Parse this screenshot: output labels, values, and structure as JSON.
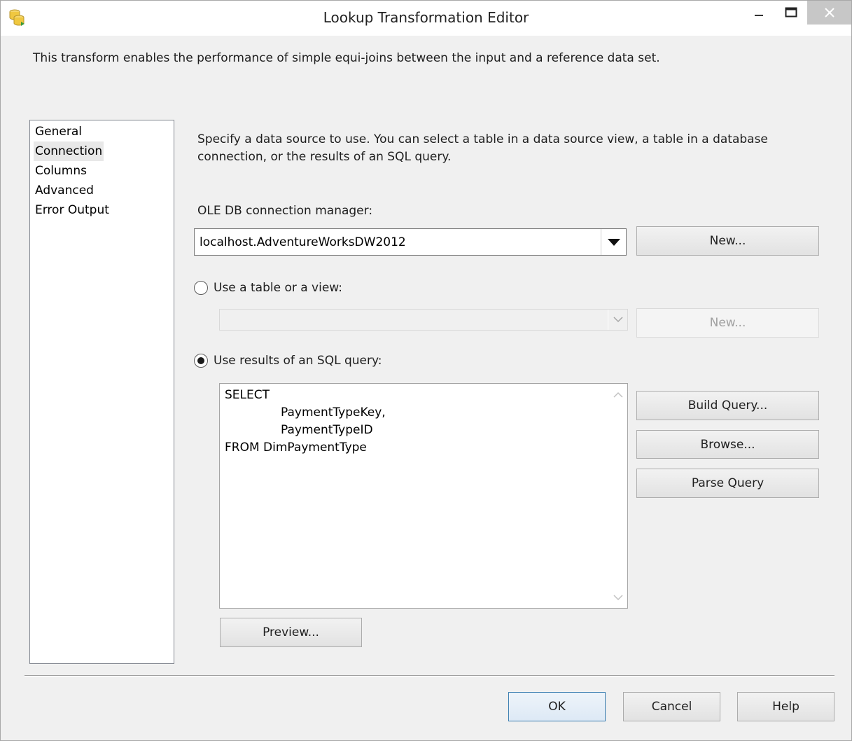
{
  "window": {
    "title": "Lookup Transformation Editor"
  },
  "description": "This transform enables the performance of simple equi-joins between the input and a reference data set.",
  "nav": {
    "items": [
      "General",
      "Connection",
      "Columns",
      "Advanced",
      "Error Output"
    ],
    "selected": "Connection"
  },
  "connection": {
    "instructions": "Specify a data source to use. You can select a table in a data source view, a table in a database connection, or the results of an SQL query.",
    "ole_db_label": "OLE DB connection manager:",
    "ole_db_value": "localhost.AdventureWorksDW2012",
    "new_connection_label": "New...",
    "table_option_label": "Use a table or a view:",
    "table_option_selected": false,
    "table_value": "",
    "new_table_label": "New...",
    "sql_option_label": "Use results of an SQL query:",
    "sql_option_selected": true,
    "query_lines": [
      "SELECT",
      "PaymentTypeKey,",
      "PaymentTypeID",
      "FROM DimPaymentType"
    ],
    "build_query_label": "Build Query...",
    "browse_label": "Browse...",
    "parse_query_label": "Parse Query",
    "preview_label": "Preview..."
  },
  "footer": {
    "ok_label": "OK",
    "cancel_label": "Cancel",
    "help_label": "Help"
  },
  "icons": {
    "app": "database-cylinders-icon",
    "minimize": "minimize-icon",
    "maximize": "maximize-icon",
    "close": "close-icon",
    "dropdown": "chevron-down-icon"
  },
  "colors": {
    "accent_border": "#3c7fb1",
    "dialog_background": "#f0f0f0"
  }
}
